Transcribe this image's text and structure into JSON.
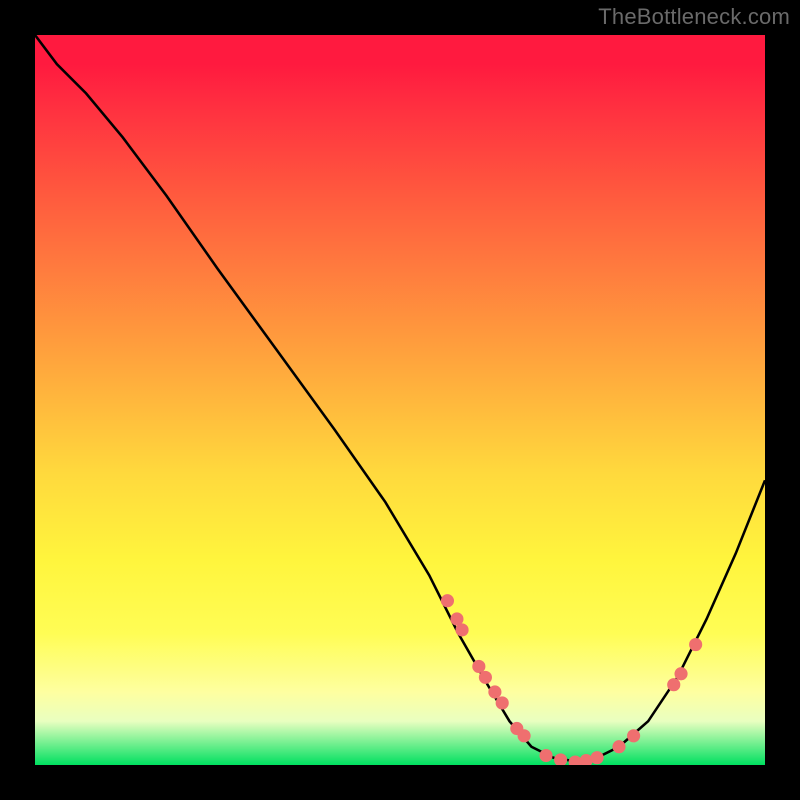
{
  "watermark": "TheBottleneck.com",
  "colors": {
    "background": "#000000",
    "curve": "#000000",
    "dots": "#ef6f6f",
    "watermark": "#6a6a6a"
  },
  "chart_data": {
    "type": "line",
    "title": "",
    "xlabel": "",
    "ylabel": "",
    "xlim": [
      0,
      100
    ],
    "ylim": [
      0,
      100
    ],
    "legend": false,
    "grid": false,
    "curve": {
      "name": "bottleneck-curve",
      "x": [
        0,
        3,
        7,
        12,
        18,
        25,
        33,
        41,
        48,
        54,
        58,
        62,
        65,
        68,
        71,
        74,
        77,
        80,
        84,
        88,
        92,
        96,
        100
      ],
      "y": [
        100,
        96,
        92,
        86,
        78,
        68,
        57,
        46,
        36,
        26,
        18,
        11,
        6,
        2.5,
        1,
        0.5,
        1,
        2.5,
        6,
        12,
        20,
        29,
        39
      ]
    },
    "series": [
      {
        "name": "highlighted-points",
        "type": "scatter",
        "x": [
          56.5,
          57.8,
          58.5,
          60.8,
          61.7,
          63.0,
          64.0,
          66.0,
          67.0,
          70.0,
          72.0,
          74.0,
          75.5,
          77.0,
          80.0,
          82.0,
          87.5,
          88.5,
          90.5
        ],
        "y": [
          22.5,
          20.0,
          18.5,
          13.5,
          12.0,
          10.0,
          8.5,
          5.0,
          4.0,
          1.3,
          0.7,
          0.4,
          0.6,
          1.0,
          2.5,
          4.0,
          11.0,
          12.5,
          16.5
        ]
      }
    ]
  }
}
